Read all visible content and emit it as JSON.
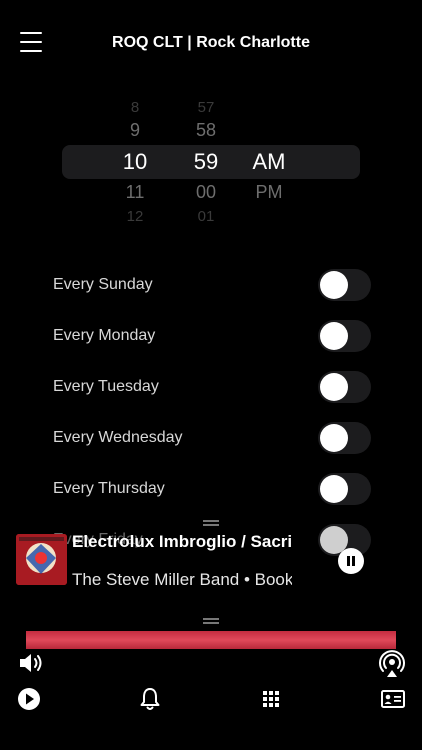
{
  "header": {
    "title": "ROQ CLT | Rock Charlotte",
    "menu_icon": "hamburger-menu-icon"
  },
  "time_picker": {
    "hour": {
      "values": [
        "8",
        "9",
        "10",
        "11",
        "12"
      ],
      "selected": "10"
    },
    "minute": {
      "values": [
        "57",
        "58",
        "59",
        "00",
        "01"
      ],
      "selected": "59"
    },
    "ampm": {
      "values": [
        "AM",
        "PM"
      ],
      "selected": "AM"
    }
  },
  "repeat_days": [
    {
      "label": "Every Sunday",
      "on": false
    },
    {
      "label": "Every Monday",
      "on": false
    },
    {
      "label": "Every Tuesday",
      "on": false
    },
    {
      "label": "Every Wednesday",
      "on": false
    },
    {
      "label": "Every Thursday",
      "on": false
    },
    {
      "label": "Every Friday",
      "on": false
    }
  ],
  "now_playing": {
    "track": "Electrolux Imbroglio / Sacrifice",
    "artist_line": "The Steve Miller Band • Book of Dreams",
    "state": "playing",
    "pause_icon": "pause-icon"
  },
  "colors": {
    "background": "#000000",
    "banner": "#d83a4e",
    "toggle_track": "#1c1c1e"
  },
  "controls": {
    "volume_icon": "speaker-icon",
    "airplay_icon": "airplay-icon"
  },
  "tabbar": {
    "tabs": [
      "play-icon",
      "bell-icon",
      "grid-icon",
      "contact-card-icon"
    ]
  }
}
